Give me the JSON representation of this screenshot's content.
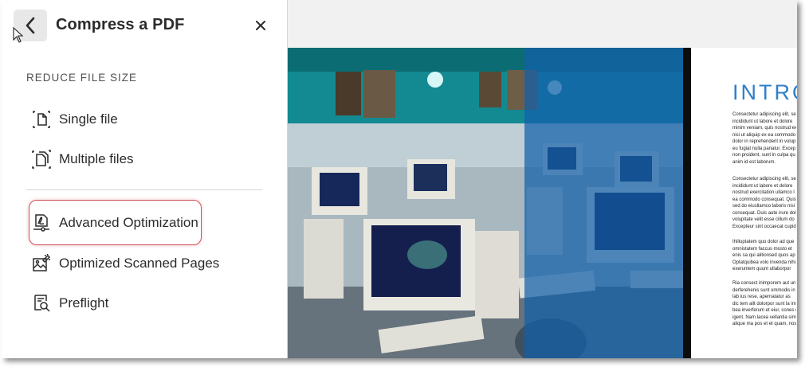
{
  "panel": {
    "title": "Compress a PDF",
    "section_label": "REDUCE FILE SIZE",
    "items": [
      {
        "label": "Single file",
        "icon": "single-file-compress-icon"
      },
      {
        "label": "Multiple files",
        "icon": "multiple-files-compress-icon"
      },
      {
        "label": "Advanced Optimization",
        "icon": "advanced-optimization-icon"
      },
      {
        "label": "Optimized Scanned Pages",
        "icon": "optimize-scanned-pages-icon"
      },
      {
        "label": "Preflight",
        "icon": "preflight-icon"
      }
    ],
    "highlight_color": "#d0505a"
  },
  "preview": {
    "heading": "INTRO",
    "paragraphs": [
      [
        "Consectetur adipiscing elit, se",
        "incididunt ut labore et dolore",
        "minim veniam, quis nostrud ex",
        "nisi ut aliquip ex ea commodo",
        "dolor in reprehenderit in volup",
        "eu fugiat nulla pariatur. Excep",
        "non proident, sunt in culpa qu",
        "anim id est laborum."
      ],
      [
        "Consectetur adipiscing elit, se",
        "incididunt ut labore et dolore",
        "nostrud exercitation ullamco l",
        "ea commodo consequat. Quis",
        "sed do eiusllamco laboris nisi",
        "consequat. Duis aute irure dol",
        "volupitate velit esse cillum do",
        "Excepteur sint occaecat cupid"
      ],
      [
        "Ihilluptatem quo dolor ad que",
        "omnistatem faccus mosto et",
        "enis sa qui alitionsed quos ap",
        "Optatquibea volo invenda nihi",
        "exeruntem quunt ullaborpor"
      ],
      [
        "Ria consect inimporem aut un",
        "derferehenis sunt ommodis in",
        "lab ius rese, apernatatur as",
        "dic tem alit dolorpor sunt la im",
        "bea inverferum et eiur, cones c",
        "igent. Nam lacea vellantia sim",
        "alique ma pos et et quam, nos"
      ]
    ]
  }
}
